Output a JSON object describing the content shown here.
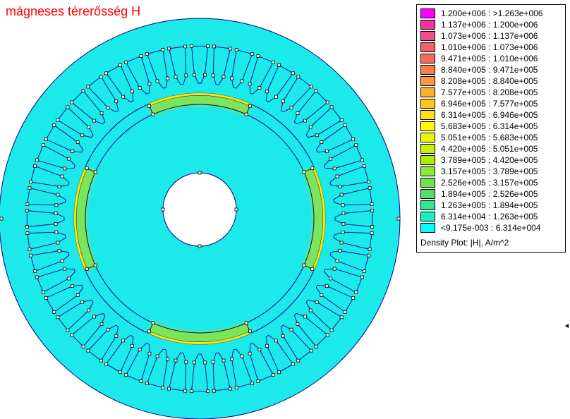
{
  "title": "mágneses térerősség H",
  "legend": {
    "caption": "Density Plot: |H|, A/m^2",
    "entries": [
      {
        "label": "1.200e+006 : >1.263e+006",
        "color": "#ff00ff"
      },
      {
        "label": "1.137e+006 : 1.200e+006",
        "color": "#f2339e"
      },
      {
        "label": "1.073e+006 : 1.137e+006",
        "color": "#f44c86"
      },
      {
        "label": "1.010e+006 : 1.073e+006",
        "color": "#f75e6a"
      },
      {
        "label": "9.471e+005 : 1.010e+006",
        "color": "#f86a58"
      },
      {
        "label": "8.840e+005 : 9.471e+005",
        "color": "#fb7f47"
      },
      {
        "label": "8.208e+005 : 8.840e+005",
        "color": "#fd9738"
      },
      {
        "label": "7.577e+005 : 8.208e+005",
        "color": "#feae28"
      },
      {
        "label": "6.946e+005 : 7.577e+005",
        "color": "#ffc31c"
      },
      {
        "label": "6.314e+005 : 6.946e+005",
        "color": "#ffde12"
      },
      {
        "label": "5.683e+005 : 6.314e+005",
        "color": "#fffa00"
      },
      {
        "label": "5.051e+005 : 5.683e+005",
        "color": "#e9f800"
      },
      {
        "label": "4.420e+005 : 5.051e+005",
        "color": "#c9f200"
      },
      {
        "label": "3.789e+005 : 4.420e+005",
        "color": "#a9ee00"
      },
      {
        "label": "3.157e+005 : 3.789e+005",
        "color": "#8ae935"
      },
      {
        "label": "2.526e+005 : 3.157e+005",
        "color": "#6ee24f"
      },
      {
        "label": "1.894e+005 : 2.526e+005",
        "color": "#52e06a"
      },
      {
        "label": "1.263e+005 : 1.894e+005",
        "color": "#2ee88e"
      },
      {
        "label": "6.314e+004 : 1.263e+005",
        "color": "#18f0c0"
      },
      {
        "label": "<9.175e-003 : 6.314e+004",
        "color": "#00ffff"
      }
    ]
  },
  "colors": {
    "background_field": "#1ce9e9",
    "mesh_lines": "#00008b",
    "magnet_fill": "#7be55a",
    "magnet_edge": "#ffe600",
    "title": "#ff0000"
  }
}
